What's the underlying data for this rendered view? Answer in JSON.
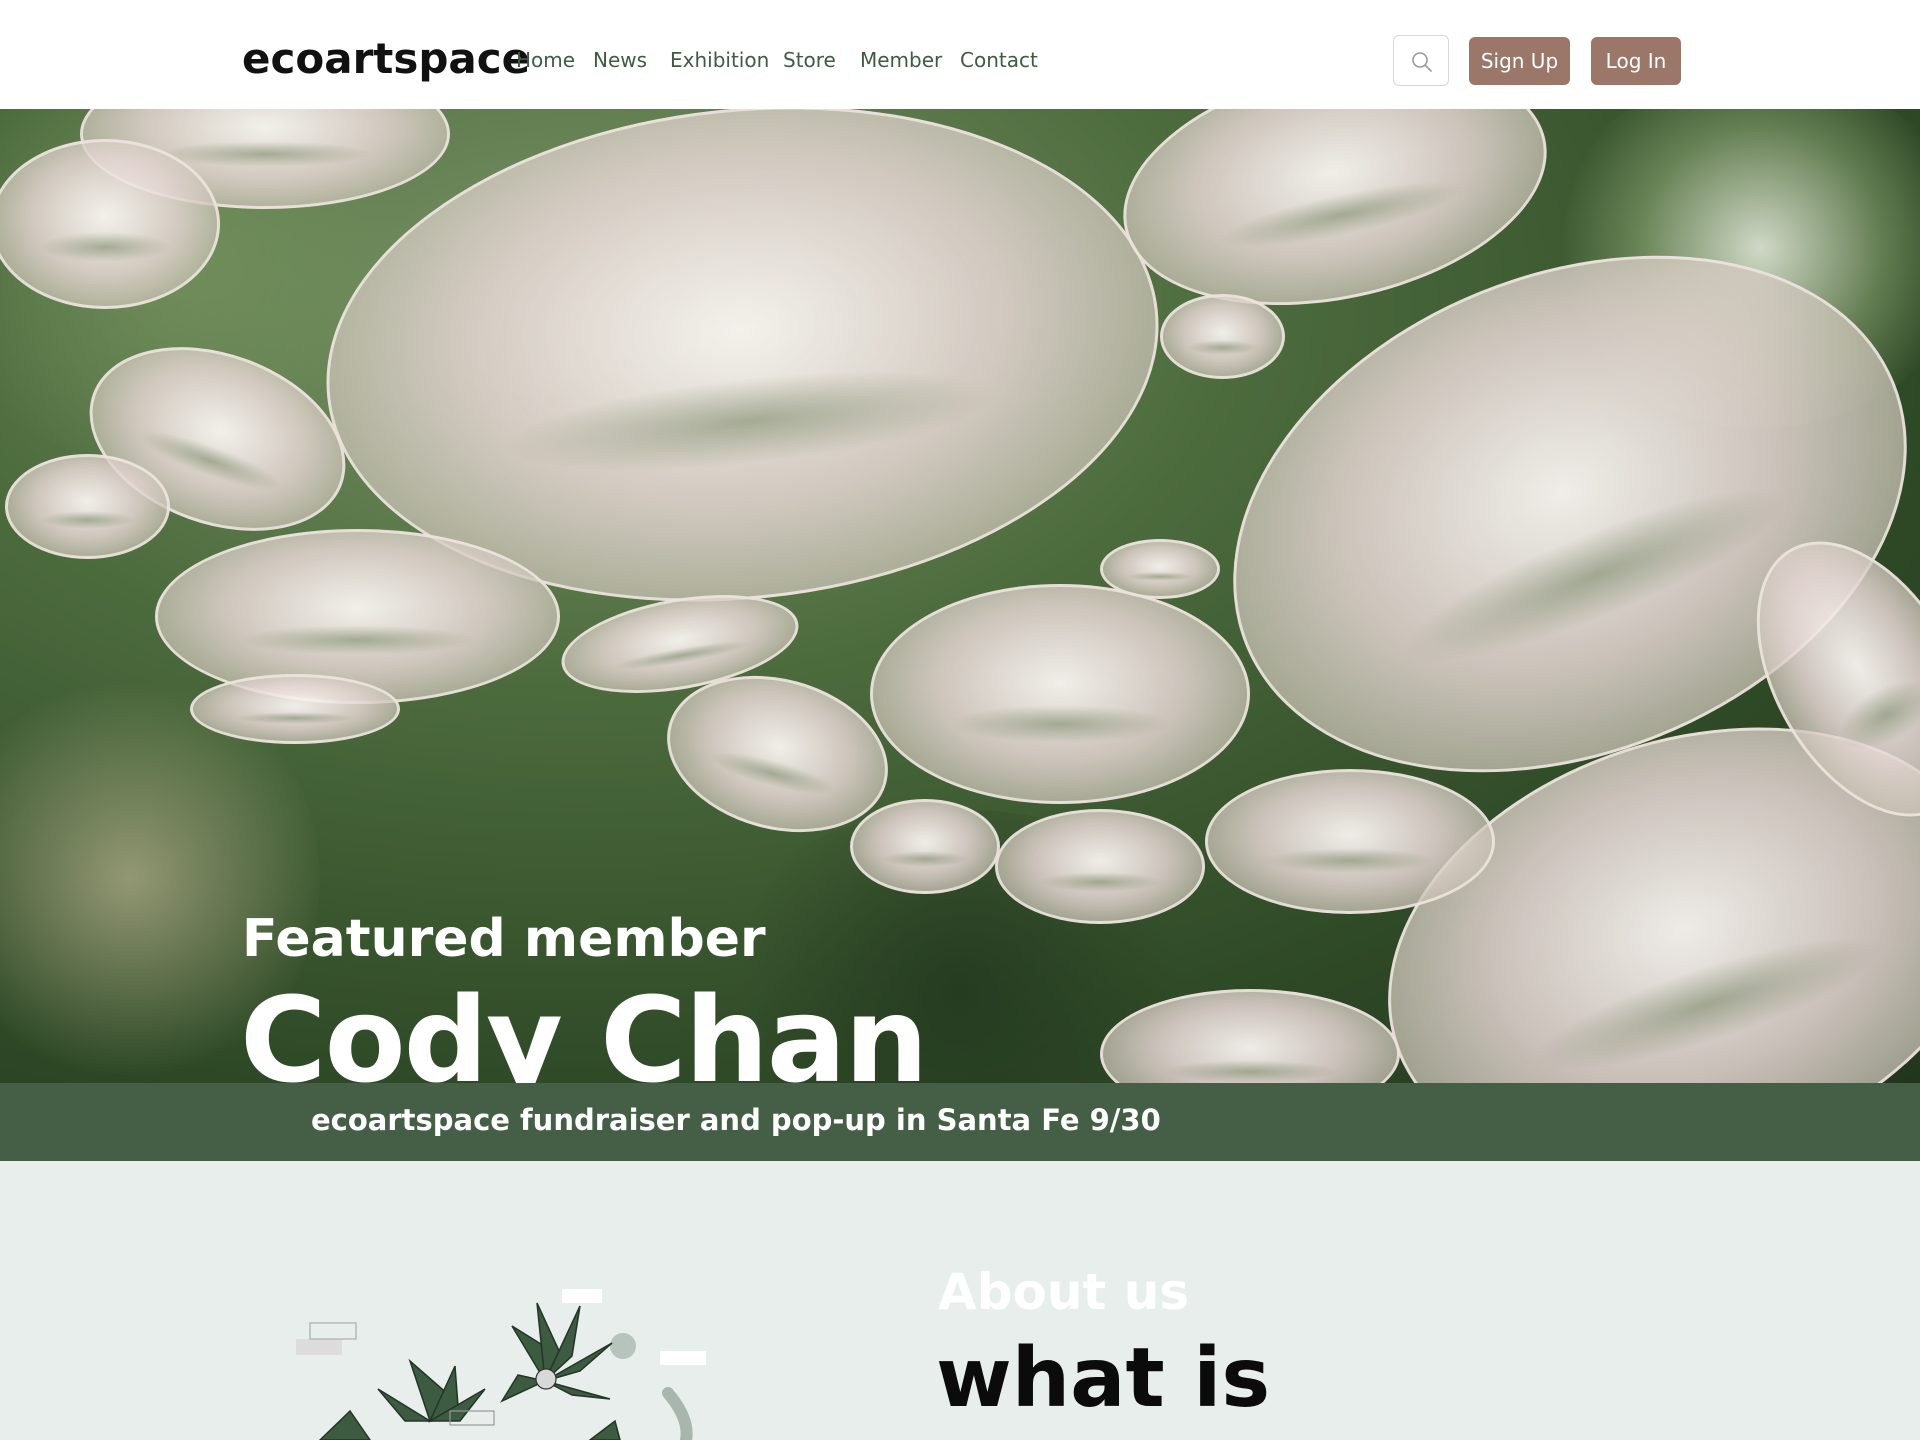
{
  "header": {
    "logo": "ecoartspace",
    "nav": [
      {
        "label": "Home"
      },
      {
        "label": "News"
      },
      {
        "label": "Exhibition"
      },
      {
        "label": "Store"
      },
      {
        "label": "Member"
      },
      {
        "label": "Contact"
      }
    ],
    "search_icon": "search-icon",
    "signup_label": "Sign Up",
    "login_label": "Log In"
  },
  "hero": {
    "label": "Featured member",
    "name": "Cody Chan"
  },
  "banner": {
    "text": "ecoartspace fundraiser and pop-up in Santa Fe 9/30"
  },
  "about": {
    "kicker": "About us",
    "heading": "what is"
  },
  "colors": {
    "button": "#9b776a",
    "nav_text": "#3f5c43",
    "banner": "#445f45",
    "about_bg": "#e8eeeb"
  }
}
